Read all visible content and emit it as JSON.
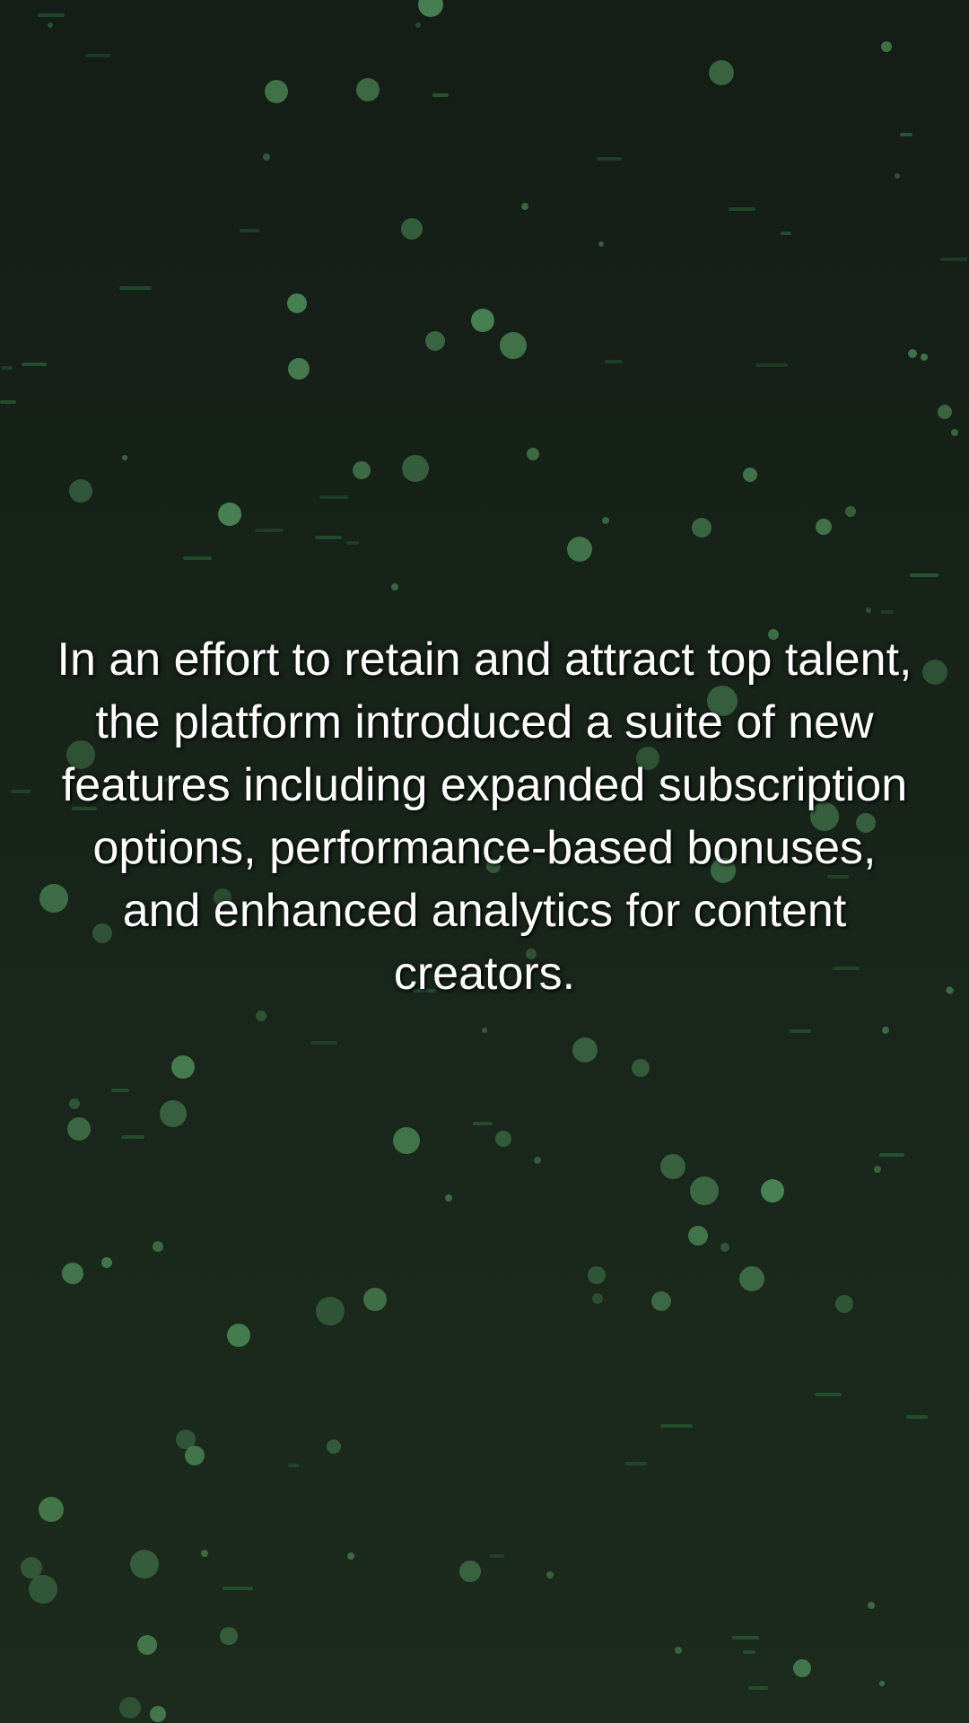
{
  "caption": {
    "text": "In an effort to retain and attract top talent, the platform introduced a suite of new features including expanded subscription options, performance-based bonuses, and enhanced analytics for content creators."
  },
  "background": {
    "gradient_top": "#141d16",
    "gradient_bottom": "#1d2b1e",
    "particle_color": "#5da86b",
    "streak_color": "#2f7a45"
  }
}
